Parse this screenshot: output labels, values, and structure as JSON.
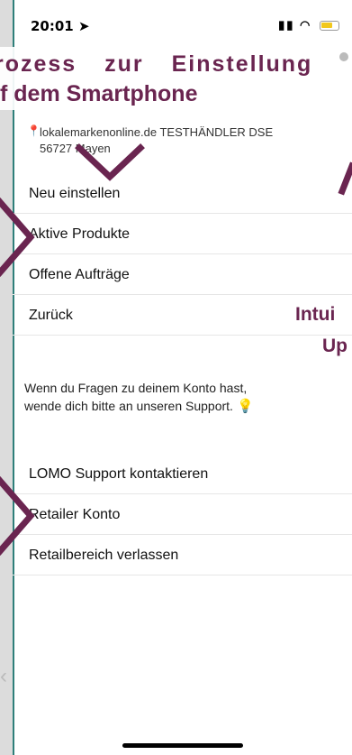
{
  "status": {
    "time": "20:01",
    "location_icon": "navigation-arrow-icon",
    "signal_icon": "signal-icon",
    "wifi_icon": "wifi-icon",
    "battery_icon": "battery-charging-icon"
  },
  "banner": {
    "line1": "rozess zur Einstellung",
    "line2": "f dem Smartphone"
  },
  "account": {
    "location_line1": "lokalemarkenonline.de TESTHÄNDLER DSE",
    "location_line2": "56727 Mayen",
    "pin_icon": "location-pin-icon"
  },
  "menu": {
    "items": [
      "Neu einstellen",
      "Aktive Produkte",
      "Offene Aufträge",
      "Zurück"
    ]
  },
  "support": {
    "text_line1": "Wenn du Fragen zu deinem Konto hast,",
    "text_line2": "wende dich bitte an unseren Support."
  },
  "menu2": {
    "items": [
      "LOMO Support kontaktieren",
      "Retailer Konto",
      "Retailbereich verlassen"
    ]
  },
  "side_annotation": {
    "line1": "Intui",
    "line2": "Up"
  },
  "colors": {
    "accent": "#6a2550",
    "frame": "#2f7f7a"
  }
}
